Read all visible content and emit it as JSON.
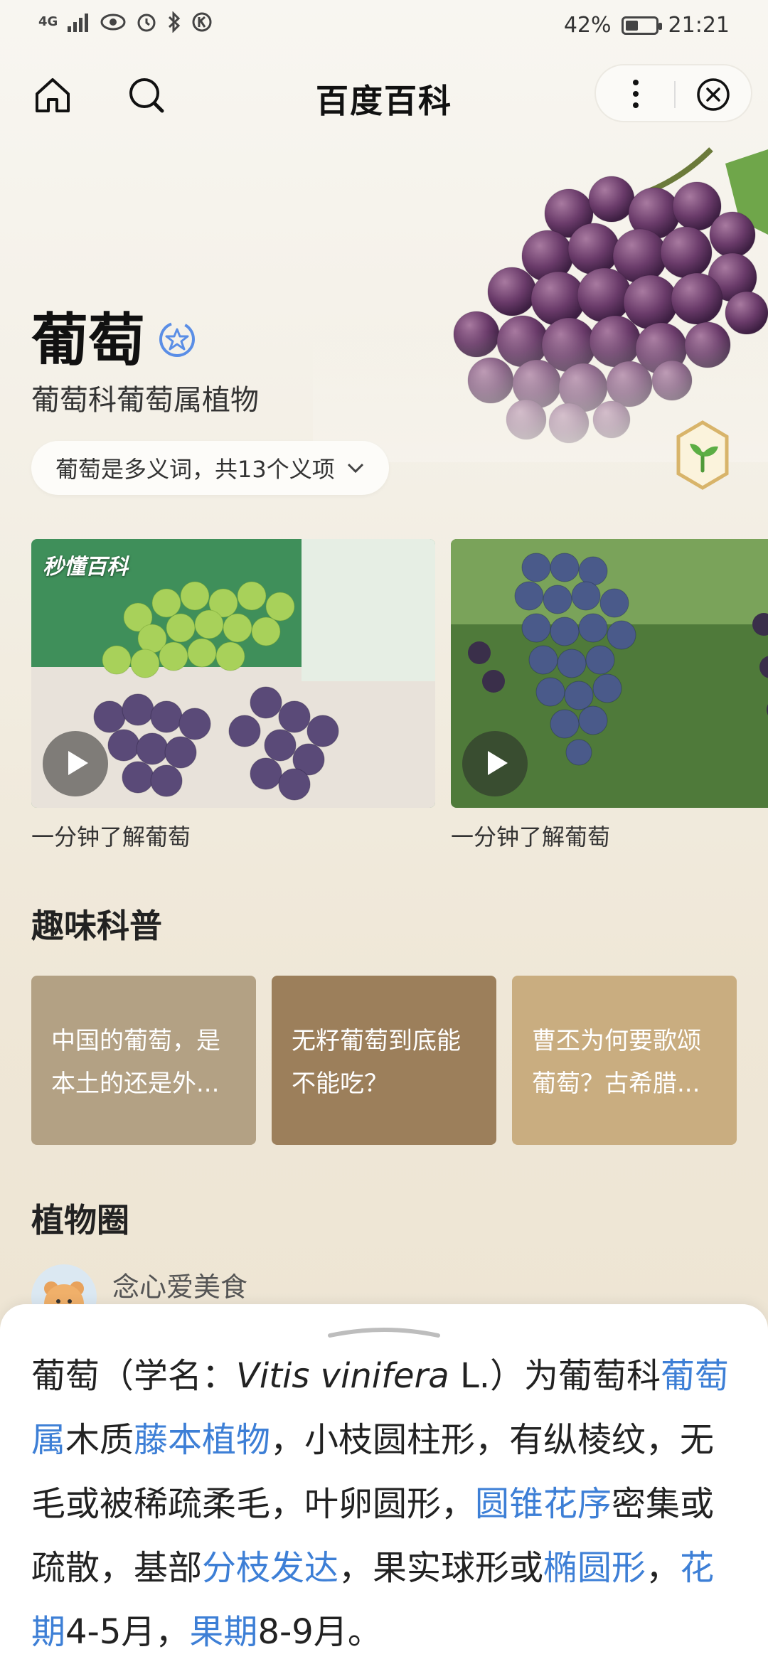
{
  "status_bar": {
    "network": "4G",
    "battery_percent": "42%",
    "battery_level": 0.42,
    "time": "21:21"
  },
  "nav": {
    "title": "百度百科"
  },
  "entry": {
    "title": "葡萄",
    "subtitle": "葡萄科葡萄属植物",
    "polysemy_label": "葡萄是多义词，共13个义项"
  },
  "videos": [
    {
      "caption": "一分钟了解葡萄",
      "brand": "秒懂百科"
    },
    {
      "caption": "一分钟了解葡萄"
    }
  ],
  "fun_science": {
    "title": "趣味科普",
    "cards": [
      {
        "line1": "中国的葡萄，是",
        "line2": "本土的还是外...",
        "color": "#b3a184"
      },
      {
        "line1": "无籽葡萄到底能",
        "line2": "不能吃？",
        "color": "#9c7f5b"
      },
      {
        "line1": "曹丕为何要歌颂",
        "line2": "葡萄？古希腊...",
        "color": "#c9ad80"
      }
    ]
  },
  "plant_circle": {
    "title": "植物圈",
    "poster_name": "念心爱美食"
  },
  "summary": {
    "s1": "葡萄（学名：",
    "latin": "Vitis vinifera",
    "s2": " L.）为葡萄科",
    "link1": "葡萄属",
    "s3": "木质",
    "link2": "藤本植物",
    "s4": "，小枝圆柱形，有纵棱纹，无毛或被稀疏柔毛，叶卵圆形，",
    "link3": "圆锥花序",
    "s5": "密集或疏散，基部",
    "link4": "分枝发达",
    "s6": "，果实球形或",
    "link5": "椭圆形",
    "s7": "，",
    "link6": "花期",
    "s8": "4-5月，",
    "link7": "果期",
    "s9": "8-9月。"
  },
  "colors": {
    "link": "#3d7fd6",
    "badge_blue": "#5a8ee6"
  }
}
